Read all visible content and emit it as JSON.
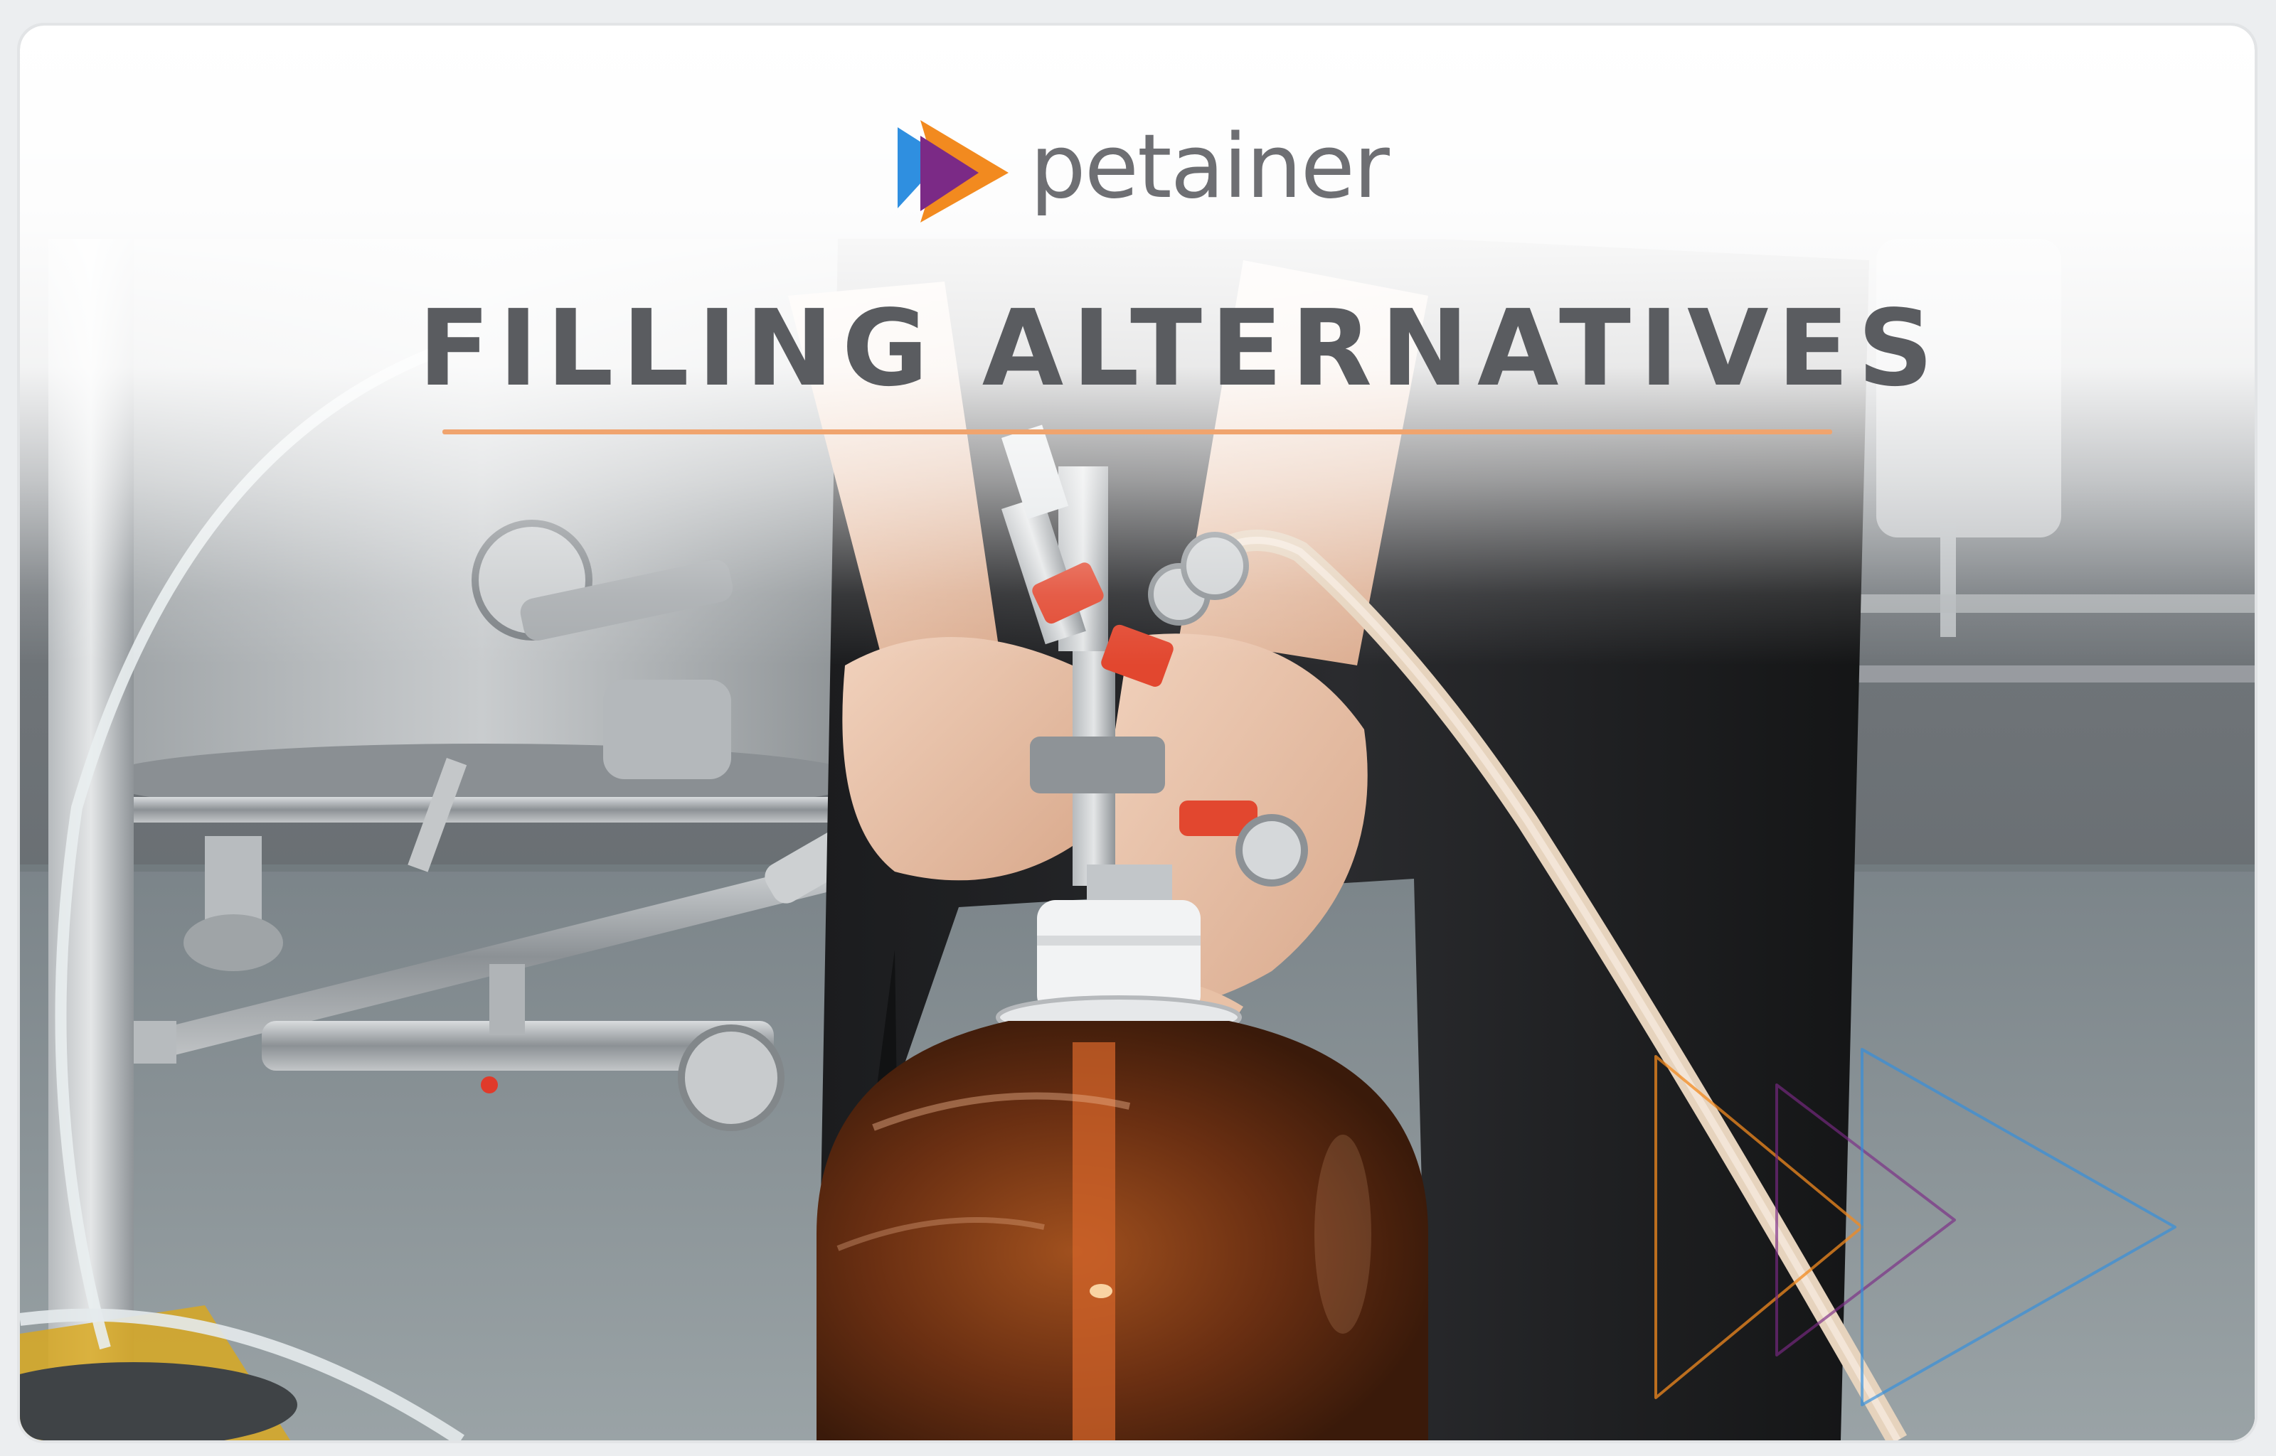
{
  "brand": {
    "name": "petainer",
    "mark_icon": "petainer-play-triangles-logo",
    "colors": {
      "blue": "#2f8fe0",
      "purple": "#7b2a86",
      "orange": "#f28a1f",
      "wordmark": "#6e6f73"
    }
  },
  "headline": {
    "text": "FILLING ALTERNATIVES",
    "underline_color": "#f0a46e"
  },
  "photo": {
    "subject": "Hands attaching a keg coupler with red-handled valves to an amber PET keg in a brewery"
  },
  "decoration": {
    "watermark_icon": "outlined-play-triangles-watermark"
  }
}
